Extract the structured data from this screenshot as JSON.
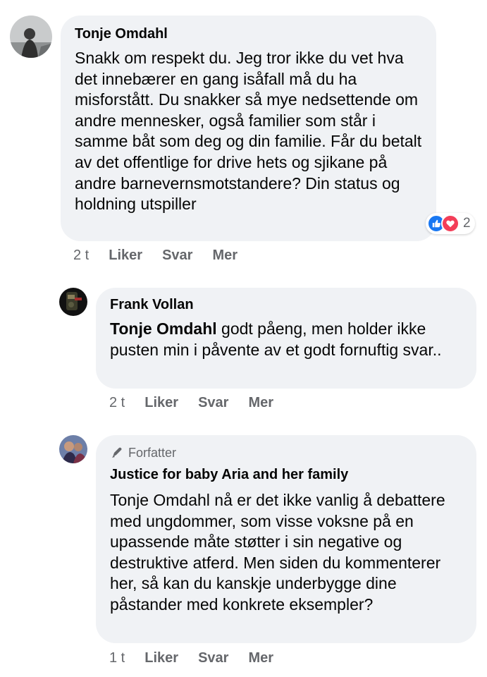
{
  "comments": [
    {
      "author": "Tonje Omdahl",
      "text": "Snakk om respekt du. Jeg tror ikke du vet hva det innebærer en gang isåfall må du ha misforstått. Du snakker så mye nedsettende om andre mennesker, også familier som står i samme båt som deg og din familie. Får du betalt av det offentlige for drive hets og sjikane på andre barnevernsmotstandere? Din status og holdning utspiller",
      "reactions": {
        "count": "2",
        "types": [
          "like-icon",
          "love-icon"
        ]
      },
      "time": "2 t",
      "actions": [
        "Liker",
        "Svar",
        "Mer"
      ]
    },
    {
      "author": "Frank Vollan",
      "mention": "Tonje Omdahl",
      "text": " godt påeng, men holder ikke pusten min i påvente av et godt fornuftig svar..",
      "time": "2 t",
      "actions": [
        "Liker",
        "Svar",
        "Mer"
      ]
    },
    {
      "badge": "Forfatter",
      "author": "Justice for baby Aria and her family",
      "text": "Tonje Omdahl nå er det ikke vanlig å debattere med ungdommer, som visse voksne på en upassende måte støtter i sin negative og destruktive atferd. Men siden du kommenterer her, så kan du kanskje underbygge dine påstander med konkrete eksempler?",
      "time": "1 t",
      "actions": [
        "Liker",
        "Svar",
        "Mer"
      ]
    }
  ],
  "colors": {
    "bubble": "#f0f2f5",
    "meta": "#65676b",
    "like": "#1877f2",
    "love": "#f33e58"
  }
}
